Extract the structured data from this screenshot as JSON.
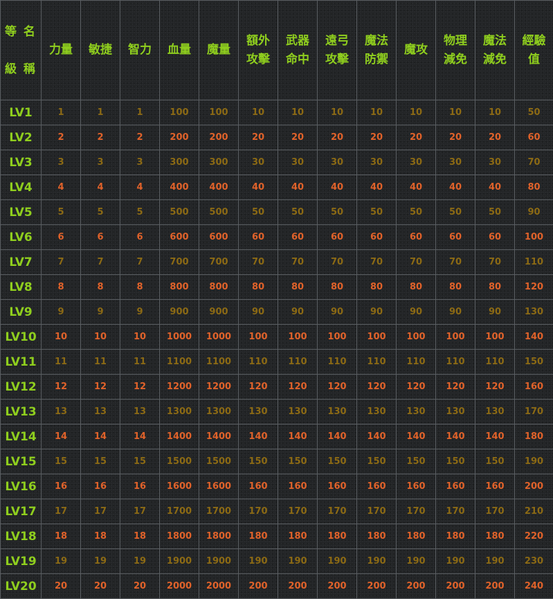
{
  "table": {
    "corner": [
      "等 名",
      "級 稱"
    ],
    "headers": [
      [
        "力量"
      ],
      [
        "敏捷"
      ],
      [
        "智力"
      ],
      [
        "血量"
      ],
      [
        "魔量"
      ],
      [
        "額外",
        "攻擊"
      ],
      [
        "武器",
        "命中"
      ],
      [
        "遠弓",
        "攻擊"
      ],
      [
        "魔法",
        "防禦"
      ],
      [
        "魔攻"
      ],
      [
        "物理",
        "減免"
      ],
      [
        "魔法",
        "減免"
      ],
      [
        "經驗",
        "值"
      ]
    ],
    "rows": [
      {
        "level": "LV1",
        "values": [
          "1",
          "1",
          "1",
          "100",
          "100",
          "10",
          "10",
          "10",
          "10",
          "10",
          "10",
          "10",
          "50"
        ]
      },
      {
        "level": "LV2",
        "values": [
          "2",
          "2",
          "2",
          "200",
          "200",
          "20",
          "20",
          "20",
          "20",
          "20",
          "20",
          "20",
          "60"
        ]
      },
      {
        "level": "LV3",
        "values": [
          "3",
          "3",
          "3",
          "300",
          "300",
          "30",
          "30",
          "30",
          "30",
          "30",
          "30",
          "30",
          "70"
        ]
      },
      {
        "level": "LV4",
        "values": [
          "4",
          "4",
          "4",
          "400",
          "400",
          "40",
          "40",
          "40",
          "40",
          "40",
          "40",
          "40",
          "80"
        ]
      },
      {
        "level": "LV5",
        "values": [
          "5",
          "5",
          "5",
          "500",
          "500",
          "50",
          "50",
          "50",
          "50",
          "50",
          "50",
          "50",
          "90"
        ]
      },
      {
        "level": "LV6",
        "values": [
          "6",
          "6",
          "6",
          "600",
          "600",
          "60",
          "60",
          "60",
          "60",
          "60",
          "60",
          "60",
          "100"
        ]
      },
      {
        "level": "LV7",
        "values": [
          "7",
          "7",
          "7",
          "700",
          "700",
          "70",
          "70",
          "70",
          "70",
          "70",
          "70",
          "70",
          "110"
        ]
      },
      {
        "level": "LV8",
        "values": [
          "8",
          "8",
          "8",
          "800",
          "800",
          "80",
          "80",
          "80",
          "80",
          "80",
          "80",
          "80",
          "120"
        ]
      },
      {
        "level": "LV9",
        "values": [
          "9",
          "9",
          "9",
          "900",
          "900",
          "90",
          "90",
          "90",
          "90",
          "90",
          "90",
          "90",
          "130"
        ]
      },
      {
        "level": "LV10",
        "values": [
          "10",
          "10",
          "10",
          "1000",
          "1000",
          "100",
          "100",
          "100",
          "100",
          "100",
          "100",
          "100",
          "140"
        ]
      },
      {
        "level": "LV11",
        "values": [
          "11",
          "11",
          "11",
          "1100",
          "1100",
          "110",
          "110",
          "110",
          "110",
          "110",
          "110",
          "110",
          "150"
        ]
      },
      {
        "level": "LV12",
        "values": [
          "12",
          "12",
          "12",
          "1200",
          "1200",
          "120",
          "120",
          "120",
          "120",
          "120",
          "120",
          "120",
          "160"
        ]
      },
      {
        "level": "LV13",
        "values": [
          "13",
          "13",
          "13",
          "1300",
          "1300",
          "130",
          "130",
          "130",
          "130",
          "130",
          "130",
          "130",
          "170"
        ]
      },
      {
        "level": "LV14",
        "values": [
          "14",
          "14",
          "14",
          "1400",
          "1400",
          "140",
          "140",
          "140",
          "140",
          "140",
          "140",
          "140",
          "180"
        ]
      },
      {
        "level": "LV15",
        "values": [
          "15",
          "15",
          "15",
          "1500",
          "1500",
          "150",
          "150",
          "150",
          "150",
          "150",
          "150",
          "150",
          "190"
        ]
      },
      {
        "level": "LV16",
        "values": [
          "16",
          "16",
          "16",
          "1600",
          "1600",
          "160",
          "160",
          "160",
          "160",
          "160",
          "160",
          "160",
          "200"
        ]
      },
      {
        "level": "LV17",
        "values": [
          "17",
          "17",
          "17",
          "1700",
          "1700",
          "170",
          "170",
          "170",
          "170",
          "170",
          "170",
          "170",
          "210"
        ]
      },
      {
        "level": "LV18",
        "values": [
          "18",
          "18",
          "18",
          "1800",
          "1800",
          "180",
          "180",
          "180",
          "180",
          "180",
          "180",
          "180",
          "220"
        ]
      },
      {
        "level": "LV19",
        "values": [
          "19",
          "19",
          "19",
          "1900",
          "1900",
          "190",
          "190",
          "190",
          "190",
          "190",
          "190",
          "190",
          "230"
        ]
      },
      {
        "level": "LV20",
        "values": [
          "20",
          "20",
          "20",
          "2000",
          "2000",
          "200",
          "200",
          "200",
          "200",
          "200",
          "200",
          "200",
          "240"
        ]
      }
    ]
  },
  "colors": {
    "header_text": "#8fce1e",
    "odd_row_values": "#8c6a14",
    "even_row_values": "#e0622a",
    "grid_lines": "#5a5e62",
    "background": "#222426"
  }
}
